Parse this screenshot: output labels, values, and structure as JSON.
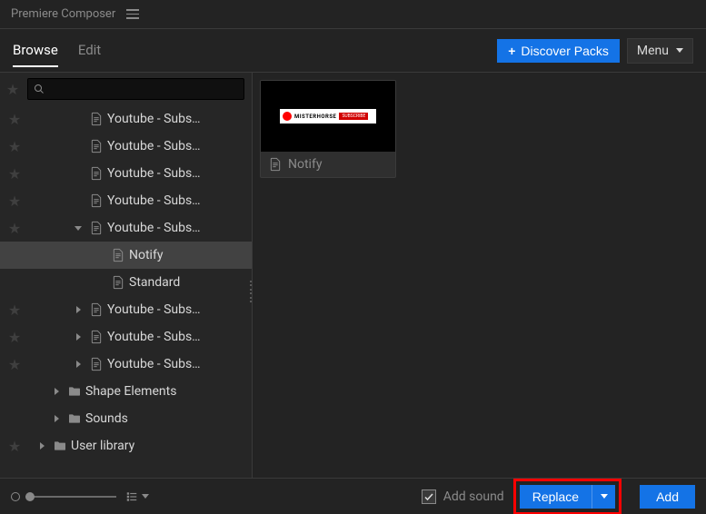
{
  "titlebar": {
    "app_name": "Premiere Composer"
  },
  "tabs": {
    "browse": "Browse",
    "edit": "Edit"
  },
  "topbar": {
    "discover_label": "Discover Packs",
    "menu_label": "Menu"
  },
  "search": {
    "placeholder": ""
  },
  "tree": {
    "items": [
      {
        "label": "Youtube - Subs…",
        "level": 1,
        "icon": "file",
        "starred": false,
        "expandable": false
      },
      {
        "label": "Youtube - Subs…",
        "level": 1,
        "icon": "file",
        "starred": false,
        "expandable": false
      },
      {
        "label": "Youtube - Subs…",
        "level": 1,
        "icon": "file",
        "starred": false,
        "expandable": false
      },
      {
        "label": "Youtube - Subs…",
        "level": 1,
        "icon": "file",
        "starred": false,
        "expandable": false
      },
      {
        "label": "Youtube - Subs…",
        "level": 1,
        "icon": "file",
        "starred": false,
        "expandable": true,
        "expanded": true
      },
      {
        "label": "Notify",
        "level": 2,
        "icon": "file",
        "starred": null,
        "expandable": false,
        "selected": true
      },
      {
        "label": "Standard",
        "level": 2,
        "icon": "file",
        "starred": null,
        "expandable": false
      },
      {
        "label": "Youtube - Subs…",
        "level": 1,
        "icon": "file",
        "starred": false,
        "expandable": true,
        "expanded": false
      },
      {
        "label": "Youtube - Subs…",
        "level": 1,
        "icon": "file",
        "starred": false,
        "expandable": true,
        "expanded": false
      },
      {
        "label": "Youtube - Subs…",
        "level": 1,
        "icon": "file",
        "starred": false,
        "expandable": true,
        "expanded": false
      },
      {
        "label": "Shape Elements",
        "level": 0,
        "icon": "folder",
        "starred": null,
        "expandable": true,
        "expanded": false
      },
      {
        "label": "Sounds",
        "level": 0,
        "icon": "folder",
        "starred": null,
        "expandable": true,
        "expanded": false
      },
      {
        "label": "User library",
        "level": -1,
        "icon": "folder",
        "starred": false,
        "expandable": true,
        "expanded": false
      }
    ]
  },
  "content": {
    "cards": [
      {
        "title": "Notify",
        "overlay_text": "MISTERHORSE",
        "overlay_button": "SUBSCRIBE"
      }
    ]
  },
  "bottombar": {
    "add_sound_label": "Add sound",
    "replace_label": "Replace",
    "add_label": "Add"
  }
}
